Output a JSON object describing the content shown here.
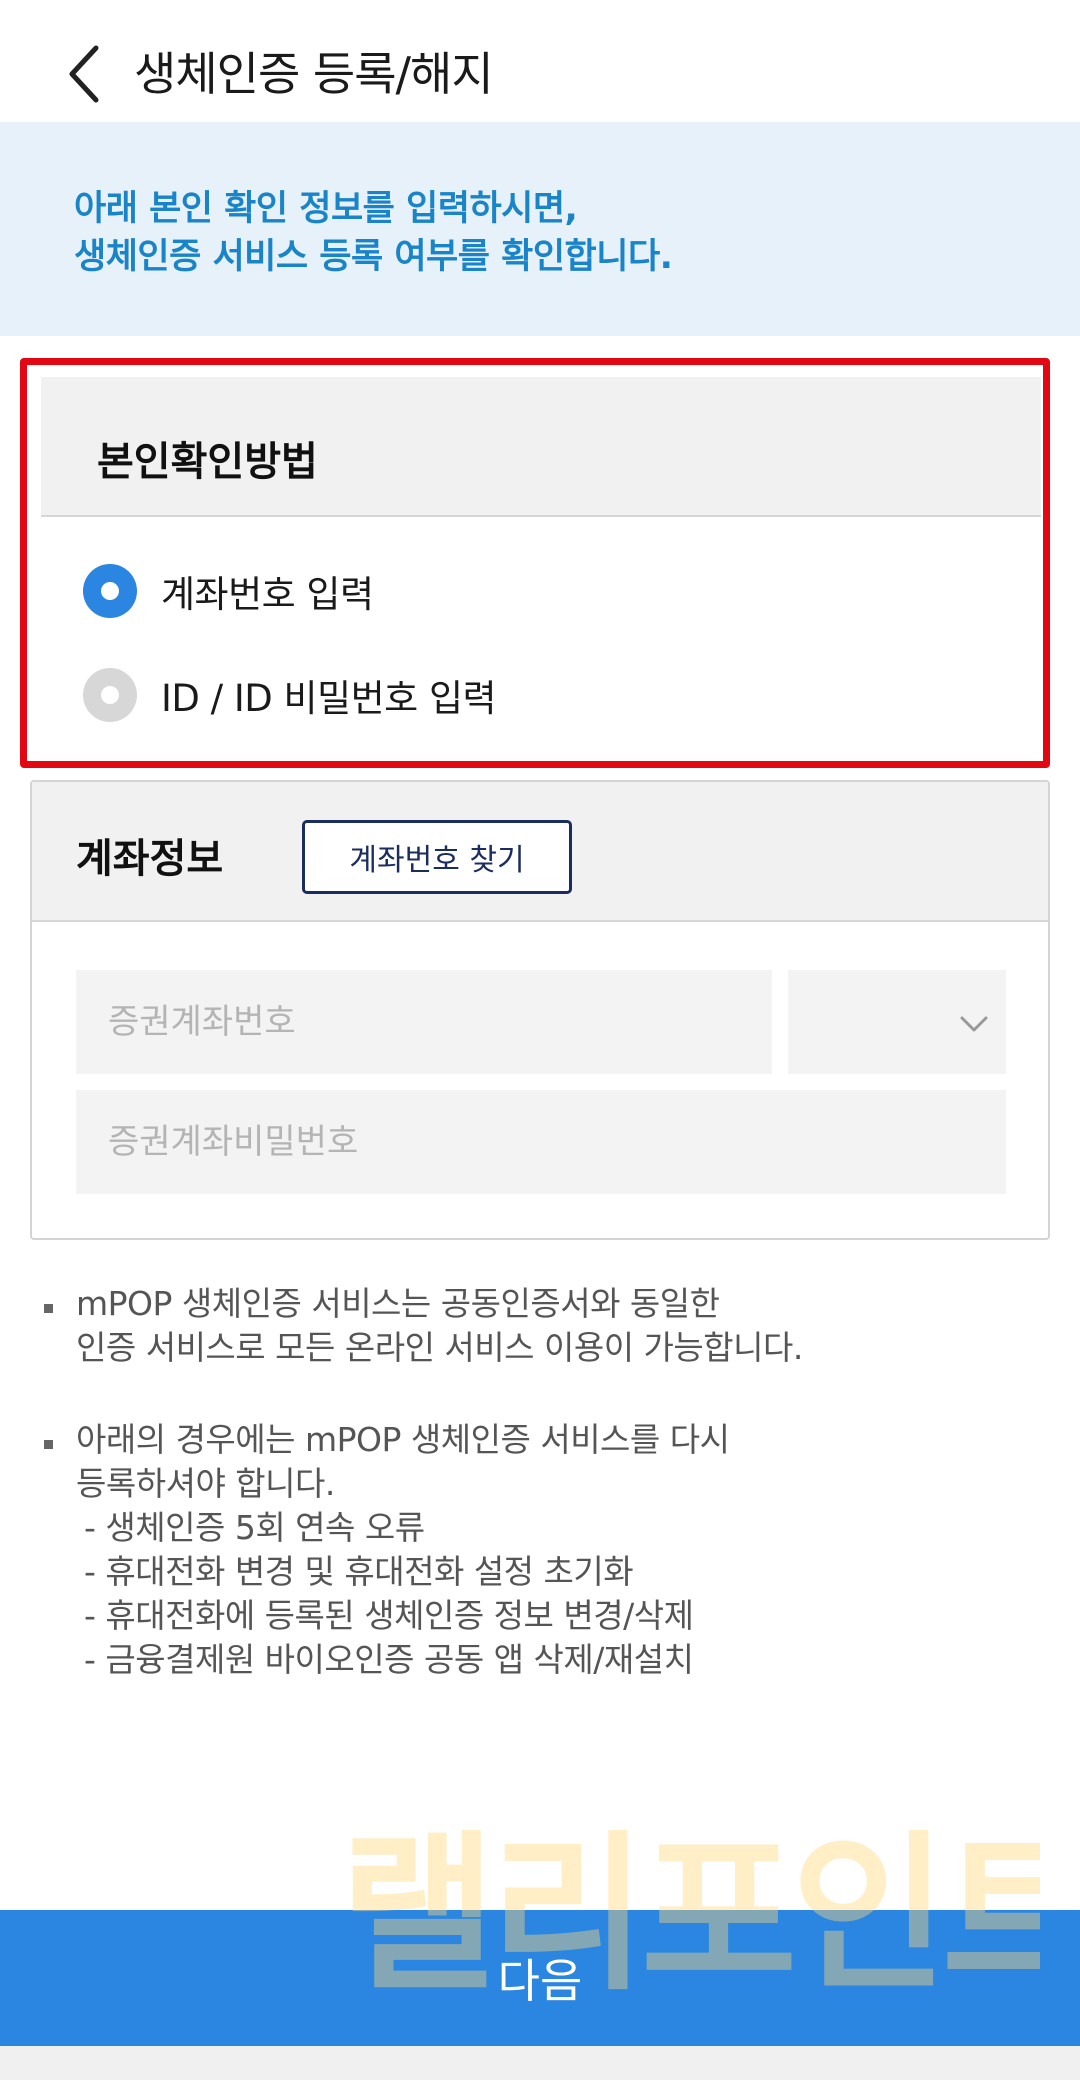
{
  "header": {
    "title": "생체인증 등록/해지"
  },
  "notice": {
    "line1": "아래 본인 확인 정보를 입력하시면,",
    "line2": "생체인증 서비스 등록 여부를 확인합니다."
  },
  "identity_method": {
    "title": "본인확인방법",
    "options": [
      {
        "label": "계좌번호 입력",
        "selected": true
      },
      {
        "label": "ID / ID 비밀번호 입력",
        "selected": false
      }
    ]
  },
  "account_info": {
    "title": "계좌정보",
    "find_button_label": "계좌번호 찾기",
    "account_number_placeholder": "증권계좌번호",
    "account_password_placeholder": "증권계좌비밀번호",
    "account_type_value": ""
  },
  "notes": {
    "note1": [
      "mPOP 생체인증 서비스는 공동인증서와 동일한",
      "인증 서비스로 모든 온라인 서비스 이용이 가능합니다."
    ],
    "note2": [
      "아래의 경우에는 mPOP 생체인증 서비스를 다시",
      "등록하셔야 합니다."
    ],
    "note2_items": [
      "- 생체인증 5회 연속 오류",
      "- 휴대전화 변경 및 휴대전화 설정 초기화",
      "- 휴대전화에 등록된 생체인증 정보 변경/삭제",
      "- 금융결제원 바이오인증 공동 앱 삭제/재설치"
    ]
  },
  "watermark": "랠리포인트",
  "footer": {
    "next_label": "다음"
  },
  "colors": {
    "accent_blue": "#2a86e0",
    "notice_text": "#1a84c8",
    "notice_bg": "#e6f1fa",
    "highlight_border": "#e30613",
    "find_button_border": "#1b2d5e"
  }
}
